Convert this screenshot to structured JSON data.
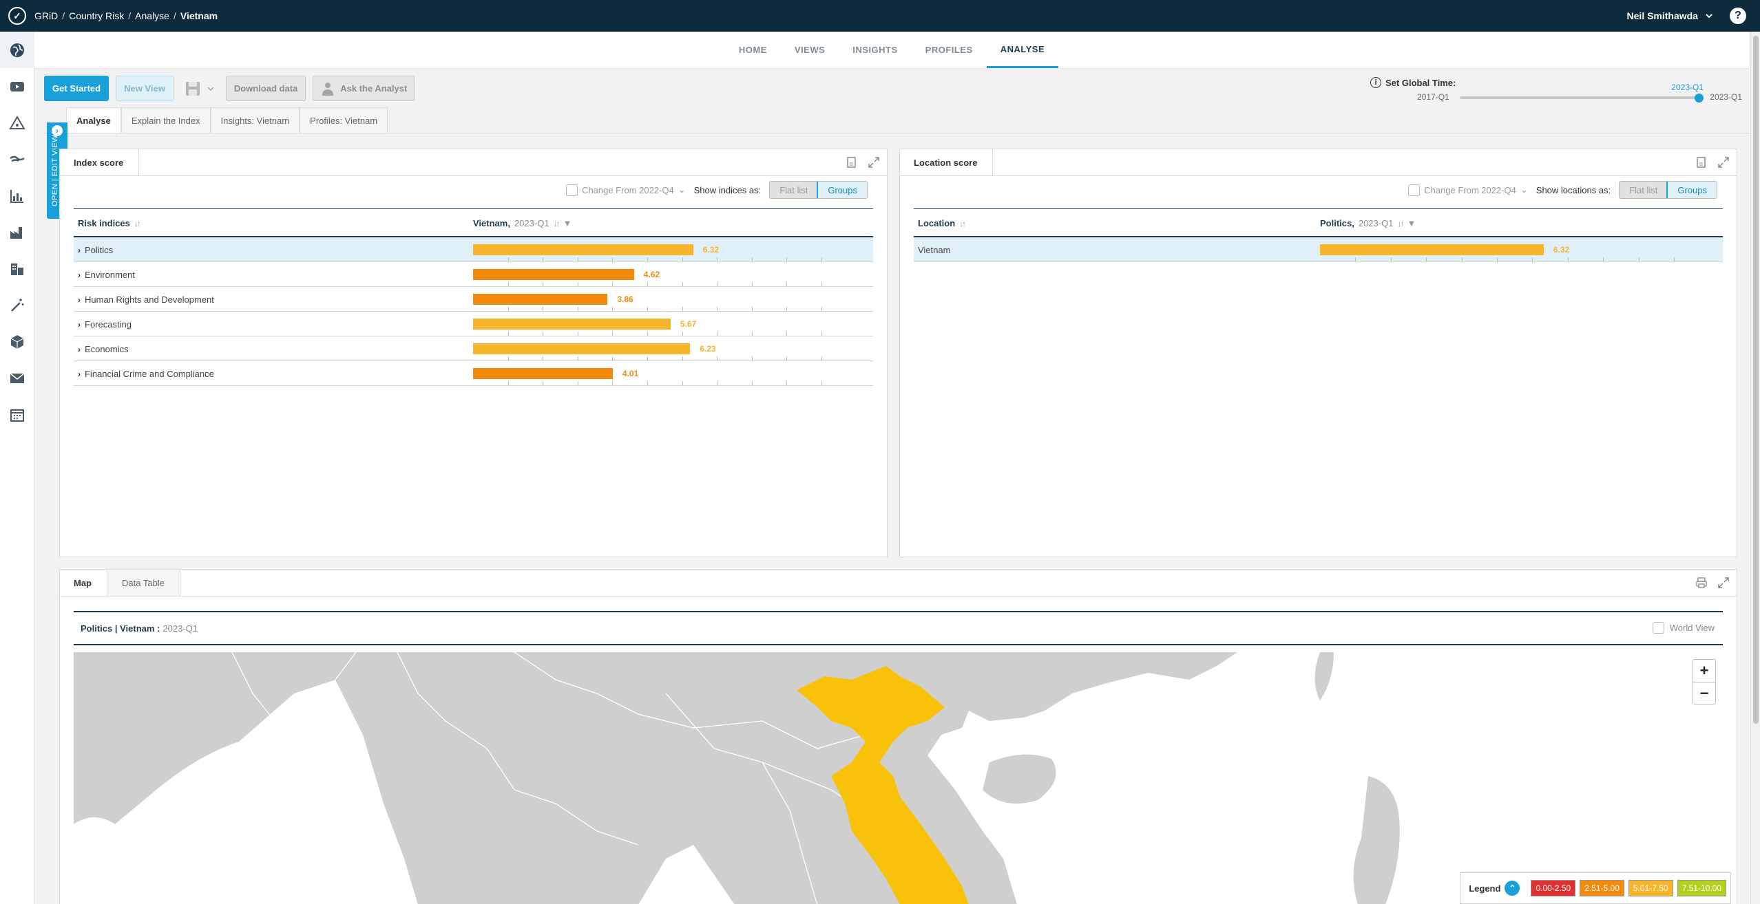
{
  "topbar": {
    "breadcrumbs": [
      "GRiD",
      "Country Risk",
      "Analyse",
      "Vietnam"
    ],
    "user": "Neil Smithawda",
    "help": "?"
  },
  "mainnav": [
    "HOME",
    "VIEWS",
    "INSIGHTS",
    "PROFILES",
    "ANALYSE"
  ],
  "toolbar": {
    "get_started": "Get Started",
    "new_view": "New View",
    "download": "Download data",
    "ask": "Ask the Analyst"
  },
  "global_time": {
    "label": "Set Global Time:",
    "start": "2017-Q1",
    "end": "2023-Q1",
    "current": "2023-Q1",
    "position_fraction": 1.0
  },
  "subtabs": [
    "Analyse",
    "Explain the Index",
    "Insights: Vietnam",
    "Profiles: Vietnam"
  ],
  "open_edit": "OPEN | EDIT VIEW",
  "index_panel": {
    "tab": "Index score",
    "change_from": "Change From 2022-Q4",
    "show_as": "Show indices as:",
    "flat": "Flat list",
    "groups": "Groups",
    "col1": "Risk indices",
    "col2_bold": "Vietnam,",
    "col2_muted": "2023-Q1",
    "rows": [
      {
        "name": "Politics",
        "value": "6.32",
        "score": 6.32,
        "color": "#f7b52b",
        "selected": true
      },
      {
        "name": "Environment",
        "value": "4.62",
        "score": 4.62,
        "color": "#f28a0c",
        "selected": false
      },
      {
        "name": "Human Rights and Development",
        "value": "3.86",
        "score": 3.86,
        "color": "#f28a0c",
        "selected": false
      },
      {
        "name": "Forecasting",
        "value": "5.67",
        "score": 5.67,
        "color": "#f7b52b",
        "selected": false
      },
      {
        "name": "Economics",
        "value": "6.23",
        "score": 6.23,
        "color": "#f7b52b",
        "selected": false
      },
      {
        "name": "Financial Crime and Compliance",
        "value": "4.01",
        "score": 4.01,
        "color": "#f28a0c",
        "selected": false
      }
    ]
  },
  "location_panel": {
    "tab": "Location score",
    "change_from": "Change From 2022-Q4",
    "show_as": "Show locations as:",
    "flat": "Flat list",
    "groups": "Groups",
    "col1": "Location",
    "col2_bold": "Politics,",
    "col2_muted": "2023-Q1",
    "rows": [
      {
        "name": "Vietnam",
        "value": "6.32",
        "score": 6.32,
        "color": "#f7b52b",
        "selected": true
      }
    ]
  },
  "map_panel": {
    "tabs": [
      "Map",
      "Data Table"
    ],
    "title_bold": "Politics | Vietnam :",
    "title_muted": "2023-Q1",
    "world_view": "World View",
    "zoom_in": "+",
    "zoom_out": "−",
    "legend_label": "Legend",
    "legend": [
      {
        "range": "0.00-2.50",
        "color": "#e03131"
      },
      {
        "range": "2.51-5.00",
        "color": "#f28a0c"
      },
      {
        "range": "5.01-7.50",
        "color": "#f7b52b"
      },
      {
        "range": "7.51-10.00",
        "color": "#b5cf1f"
      }
    ]
  },
  "colors": {
    "accent": "#1aa0d8",
    "navy": "#0e2a3d",
    "vietnam": "#f9c20a",
    "land": "#cfcfcf"
  }
}
